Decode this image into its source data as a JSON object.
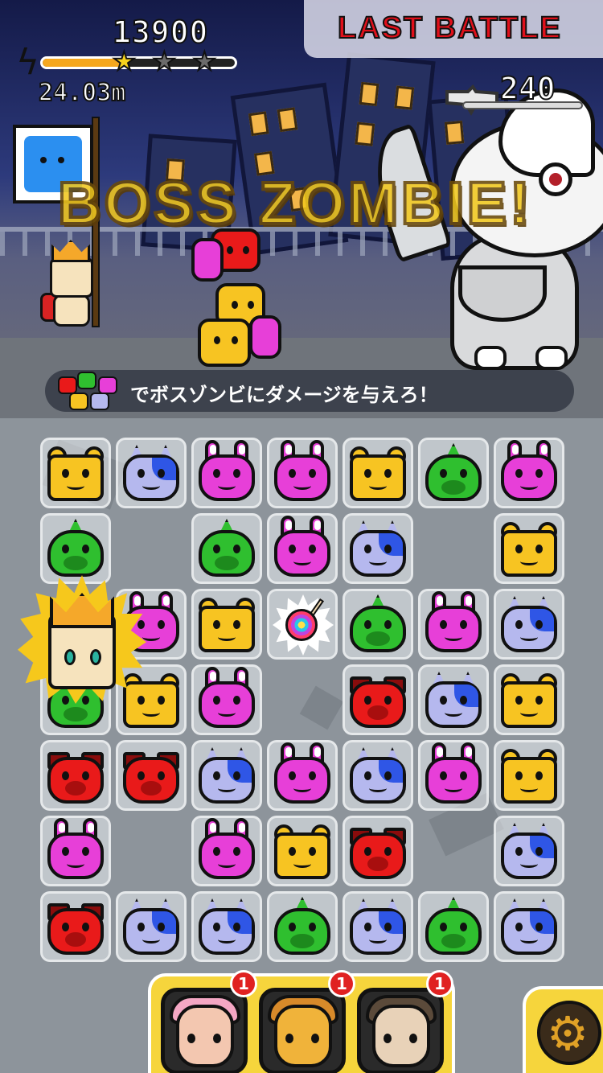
{
  "hud": {
    "score": "13900",
    "distance": "24.03m",
    "stars": "★",
    "star_empty": "★",
    "stars_earned": 1,
    "stars_total": 3,
    "progress": 0.4
  },
  "stage": {
    "title": "LAST BATTLE",
    "boss_hp": "240",
    "banner": "BOSS ZOMBIE!"
  },
  "mission": {
    "text": "でボスゾンビにダメージを与えろ！"
  },
  "board": {
    "rows": [
      [
        "bear",
        "cat",
        "bunny",
        "bunny",
        "bear",
        "dino",
        "bunny"
      ],
      [
        "dino",
        "",
        "dino",
        "bunny",
        "cat",
        "",
        "bear"
      ],
      [
        "",
        "bunny",
        "bear",
        "candy",
        "dino",
        "bunny",
        "cat"
      ],
      [
        "dino",
        "bear",
        "bunny",
        "",
        "dog",
        "cat",
        "bear"
      ],
      [
        "dog",
        "dog",
        "cat",
        "bunny",
        "cat",
        "bunny",
        "bear"
      ],
      [
        "bunny",
        "",
        "bunny",
        "bear",
        "dog",
        "",
        "cat"
      ],
      [
        "dog",
        "cat",
        "cat",
        "dino",
        "cat",
        "dino",
        "cat"
      ]
    ]
  },
  "helpers": [
    {
      "name": "flower-girl",
      "count": "1",
      "color": "#f3c7b0"
    },
    {
      "name": "yellow-warrior",
      "count": "1",
      "color": "#f0b33a"
    },
    {
      "name": "mustache-man",
      "count": "1",
      "color": "#e8d2b8"
    }
  ],
  "settings": {
    "icon": "gear-icon",
    "glyph": "⚙"
  },
  "colors": {
    "stage_title": "#e0101a",
    "banner": "#f1c81f",
    "progress": "#f5a71e",
    "tray": "#f6d53c",
    "badge": "#e02121"
  }
}
